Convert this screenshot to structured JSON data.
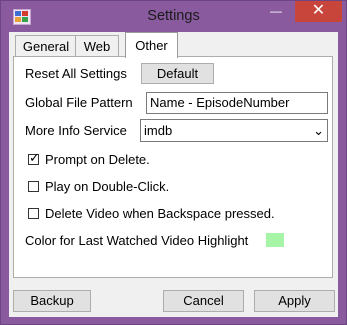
{
  "window": {
    "title": "Settings",
    "icon": "app-icon",
    "minimize_glyph": "—",
    "maximize_glyph": "□",
    "close_glyph": "✕"
  },
  "tabs": [
    {
      "label": "General"
    },
    {
      "label": "Web"
    },
    {
      "label": "Other",
      "selected": true
    }
  ],
  "other": {
    "reset_label": "Reset All Settings",
    "default_button": "Default",
    "file_pattern_label": "Global File Pattern",
    "file_pattern_value": "Name - EpisodeNumber",
    "info_service_label": "More Info Service",
    "info_service_value": "imdb",
    "prompt_delete_label": "Prompt on Delete.",
    "prompt_delete_checked": true,
    "play_double_label": "Play on Double-Click.",
    "play_double_checked": false,
    "delete_backspace_label": "Delete Video when Backspace pressed.",
    "delete_backspace_checked": false,
    "highlight_label": "Color for Last Watched Video Highlight",
    "highlight_color": "#a6f5a6"
  },
  "footer": {
    "backup": "Backup",
    "cancel": "Cancel",
    "apply": "Apply"
  }
}
